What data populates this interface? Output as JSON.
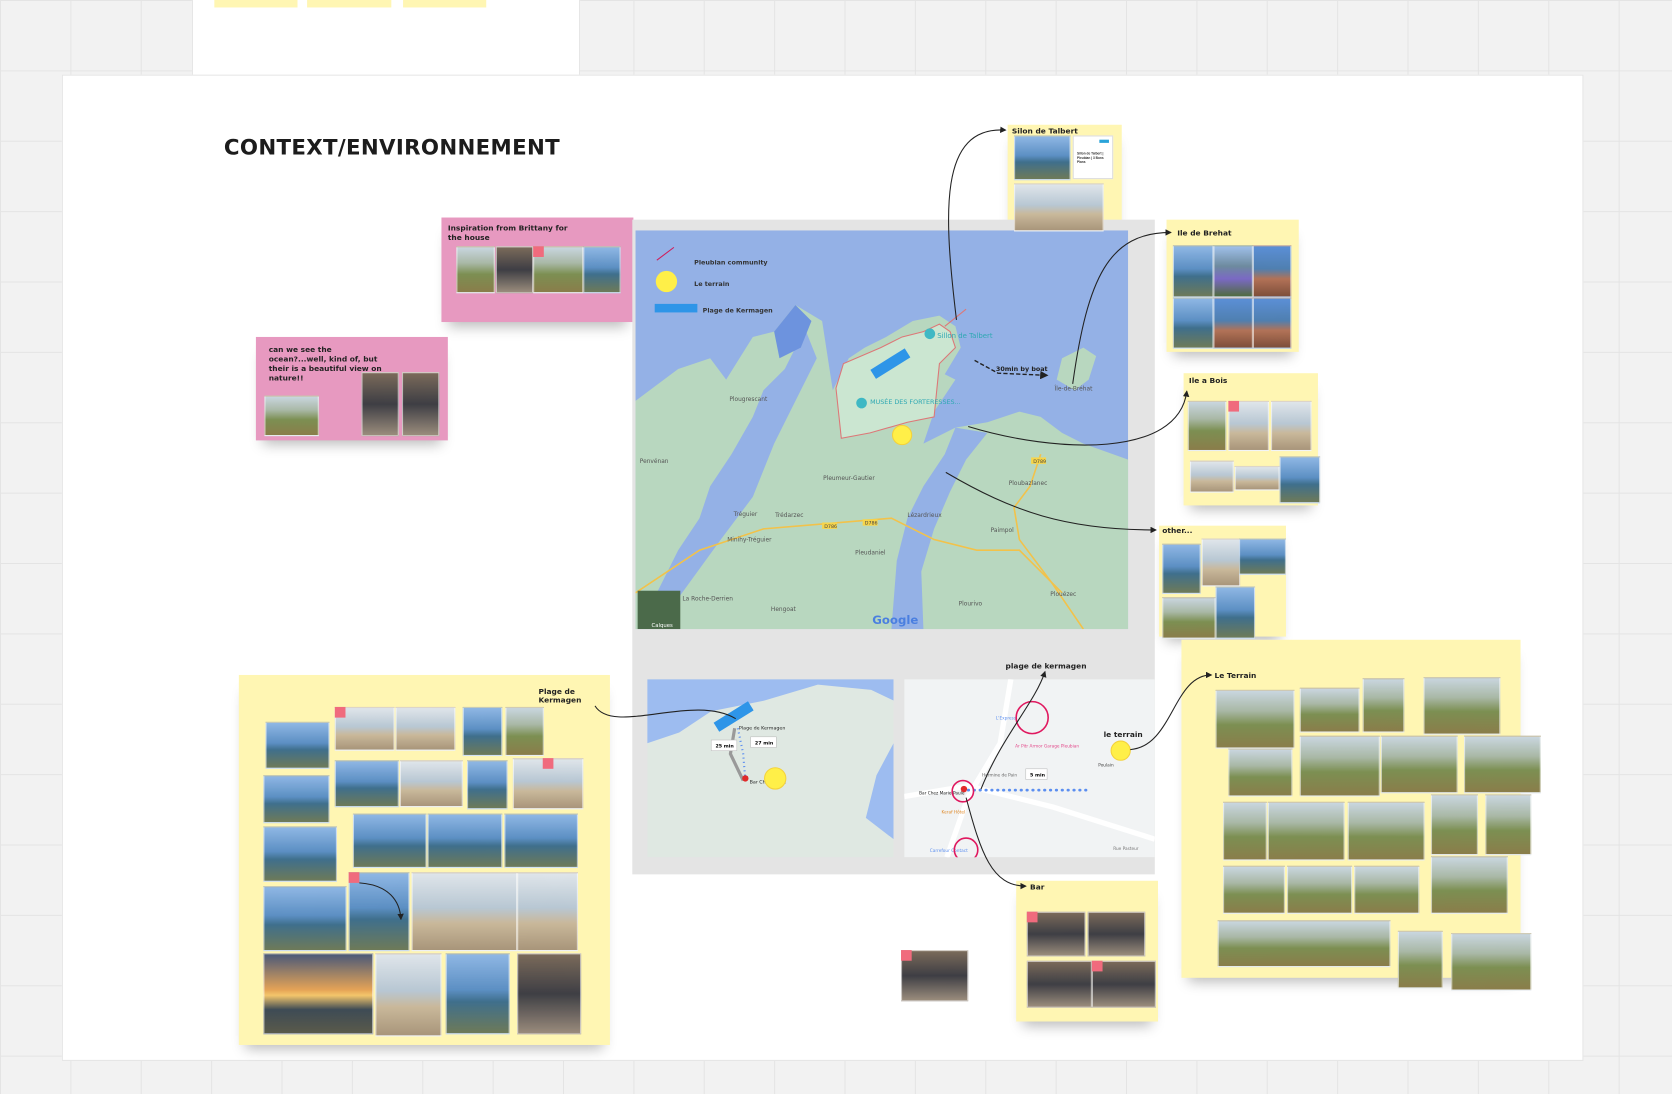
{
  "board": {
    "section_title": "CONTEXT/ENVIRONNEMENT"
  },
  "notes": {
    "inspiration": "Inspiration from Brittany for the house",
    "ocean": "can we see the ocean?...well, kind of, but their is a beautiful view on nature!!",
    "sillon": "Silon de Talbert",
    "sillon_doc_title": "Sillon de Talbert | Pleubian | 3 Bons Plans",
    "brehat": "Ile de Brehat",
    "ile_a_bois": "Ile a Bois",
    "other": "other...",
    "terrain": "Le Terrain",
    "kermagen": "Plage de Kermagen",
    "bar": "Bar",
    "plage_label": "plage de kermagen",
    "terrain_label": "le terrain"
  },
  "map": {
    "legend": {
      "community": "Pleubian community",
      "terrain": "Le terrain",
      "beach": "Plage de Kermagen"
    },
    "boat_label": "30min by boat",
    "places": {
      "sillon": "Sillon de Talbert",
      "musee": "MUSÉE DES FORTERESSES...",
      "brehat": "Île-de-Bréhat",
      "plougrescant": "Plougrescant",
      "penvenan": "Penvénan",
      "pleumeur": "Pleumeur-Gautier",
      "ploubazlanec": "Ploubazlanec",
      "treguier": "Tréguier",
      "tredarzec": "Trédarzec",
      "minihy": "Minihy-Tréguier",
      "lezardrieux": "Lézardrieux",
      "paimpol": "Paimpol",
      "pleudaniel": "Pleudaniel",
      "roche": "La Roche-Derrien",
      "hengoat": "Hengoat",
      "plourivo": "Plourivo",
      "plouezec": "Plouézec",
      "d786a": "D786",
      "d786b": "D786",
      "d789": "D789",
      "google": "Google",
      "layers": "Calques"
    },
    "route": {
      "start": "Plage de Kermagen",
      "walk1": "25 min",
      "walk2": "27 min",
      "end": "Bar Chez Marie"
    },
    "detail": {
      "walk": "5 min",
      "bar": "Bar Chez Marie-Paule",
      "place1": "Ar Pitr Armor Garage Pleubian",
      "place2": "Hermine de Pain",
      "place3": "Keraf Hôtel",
      "place4": "Carrefour Contact",
      "place5": "L'Express",
      "street": "Rue Pasteur",
      "poi": "Poulain"
    }
  },
  "colors": {
    "sticky_yellow": "#fff6b3",
    "sticky_pink": "#e799c0",
    "sea": "#94b1e6",
    "land": "#b8d7bf",
    "terrain_marker": "#ffef48",
    "beach_marker": "#2e95e8",
    "circle": "#e0185f"
  }
}
